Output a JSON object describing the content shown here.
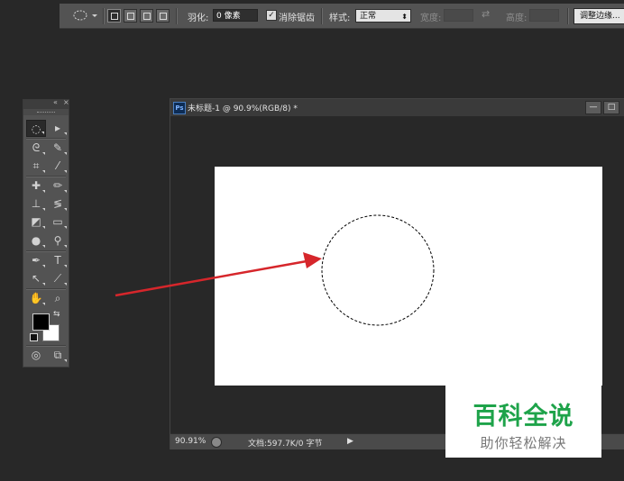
{
  "options_bar": {
    "tool_icon": "elliptical-marquee-icon",
    "feather_label": "羽化:",
    "feather_value": "0 像素",
    "antialias_checked": true,
    "antialias_label": "消除锯齿",
    "style_label": "样式:",
    "style_value": "正常",
    "width_label": "宽度:",
    "height_label": "高度:",
    "refine_edge_label": "调整边缘..."
  },
  "tools_panel": {
    "collapse_icon": "double-chevron-icon",
    "close_icon": "close-icon",
    "tools": [
      {
        "icon": "elliptical-marquee-icon",
        "glyph": "◌"
      },
      {
        "icon": "move-icon",
        "glyph": "▸"
      },
      {
        "icon": "lasso-icon",
        "glyph": "ᘓ"
      },
      {
        "icon": "quick-selection-icon",
        "glyph": "✎"
      },
      {
        "icon": "crop-icon",
        "glyph": "⌗"
      },
      {
        "icon": "eyedropper-icon",
        "glyph": "⁄"
      },
      {
        "icon": "spot-healing-icon",
        "glyph": "✚"
      },
      {
        "icon": "brush-icon",
        "glyph": "✏"
      },
      {
        "icon": "clone-stamp-icon",
        "glyph": "⊥"
      },
      {
        "icon": "history-brush-icon",
        "glyph": "≶"
      },
      {
        "icon": "eraser-icon",
        "glyph": "◩"
      },
      {
        "icon": "gradient-icon",
        "glyph": "▭"
      },
      {
        "icon": "blur-icon",
        "glyph": "●"
      },
      {
        "icon": "dodge-icon",
        "glyph": "⚲"
      },
      {
        "icon": "pen-icon",
        "glyph": "✒"
      },
      {
        "icon": "type-icon",
        "glyph": "T"
      },
      {
        "icon": "path-selection-icon",
        "glyph": "↖"
      },
      {
        "icon": "line-icon",
        "glyph": "⟋"
      },
      {
        "icon": "hand-icon",
        "glyph": "✋"
      },
      {
        "icon": "zoom-icon",
        "glyph": "⌕"
      },
      {
        "icon": "quick-mask-icon",
        "glyph": "◎"
      },
      {
        "icon": "screen-mode-icon",
        "glyph": "⧉"
      }
    ],
    "foreground_color": "#000000",
    "background_color": "#ffffff"
  },
  "document": {
    "title": "未标题-1 @ 90.9%(RGB/8) *",
    "ps_badge": "Ps",
    "minimize_glyph": "—",
    "restore_glyph": "□",
    "zoom": "90.91%",
    "doc_info": "文档:597.7K/0 字节",
    "status_arrow": "▶",
    "canvas_color": "#ffffff"
  },
  "annotation": {
    "arrow_color": "#d6262b"
  },
  "watermark": {
    "title": "百科全说",
    "subtitle": "助你轻松解决",
    "title_color": "#1ea34a"
  }
}
